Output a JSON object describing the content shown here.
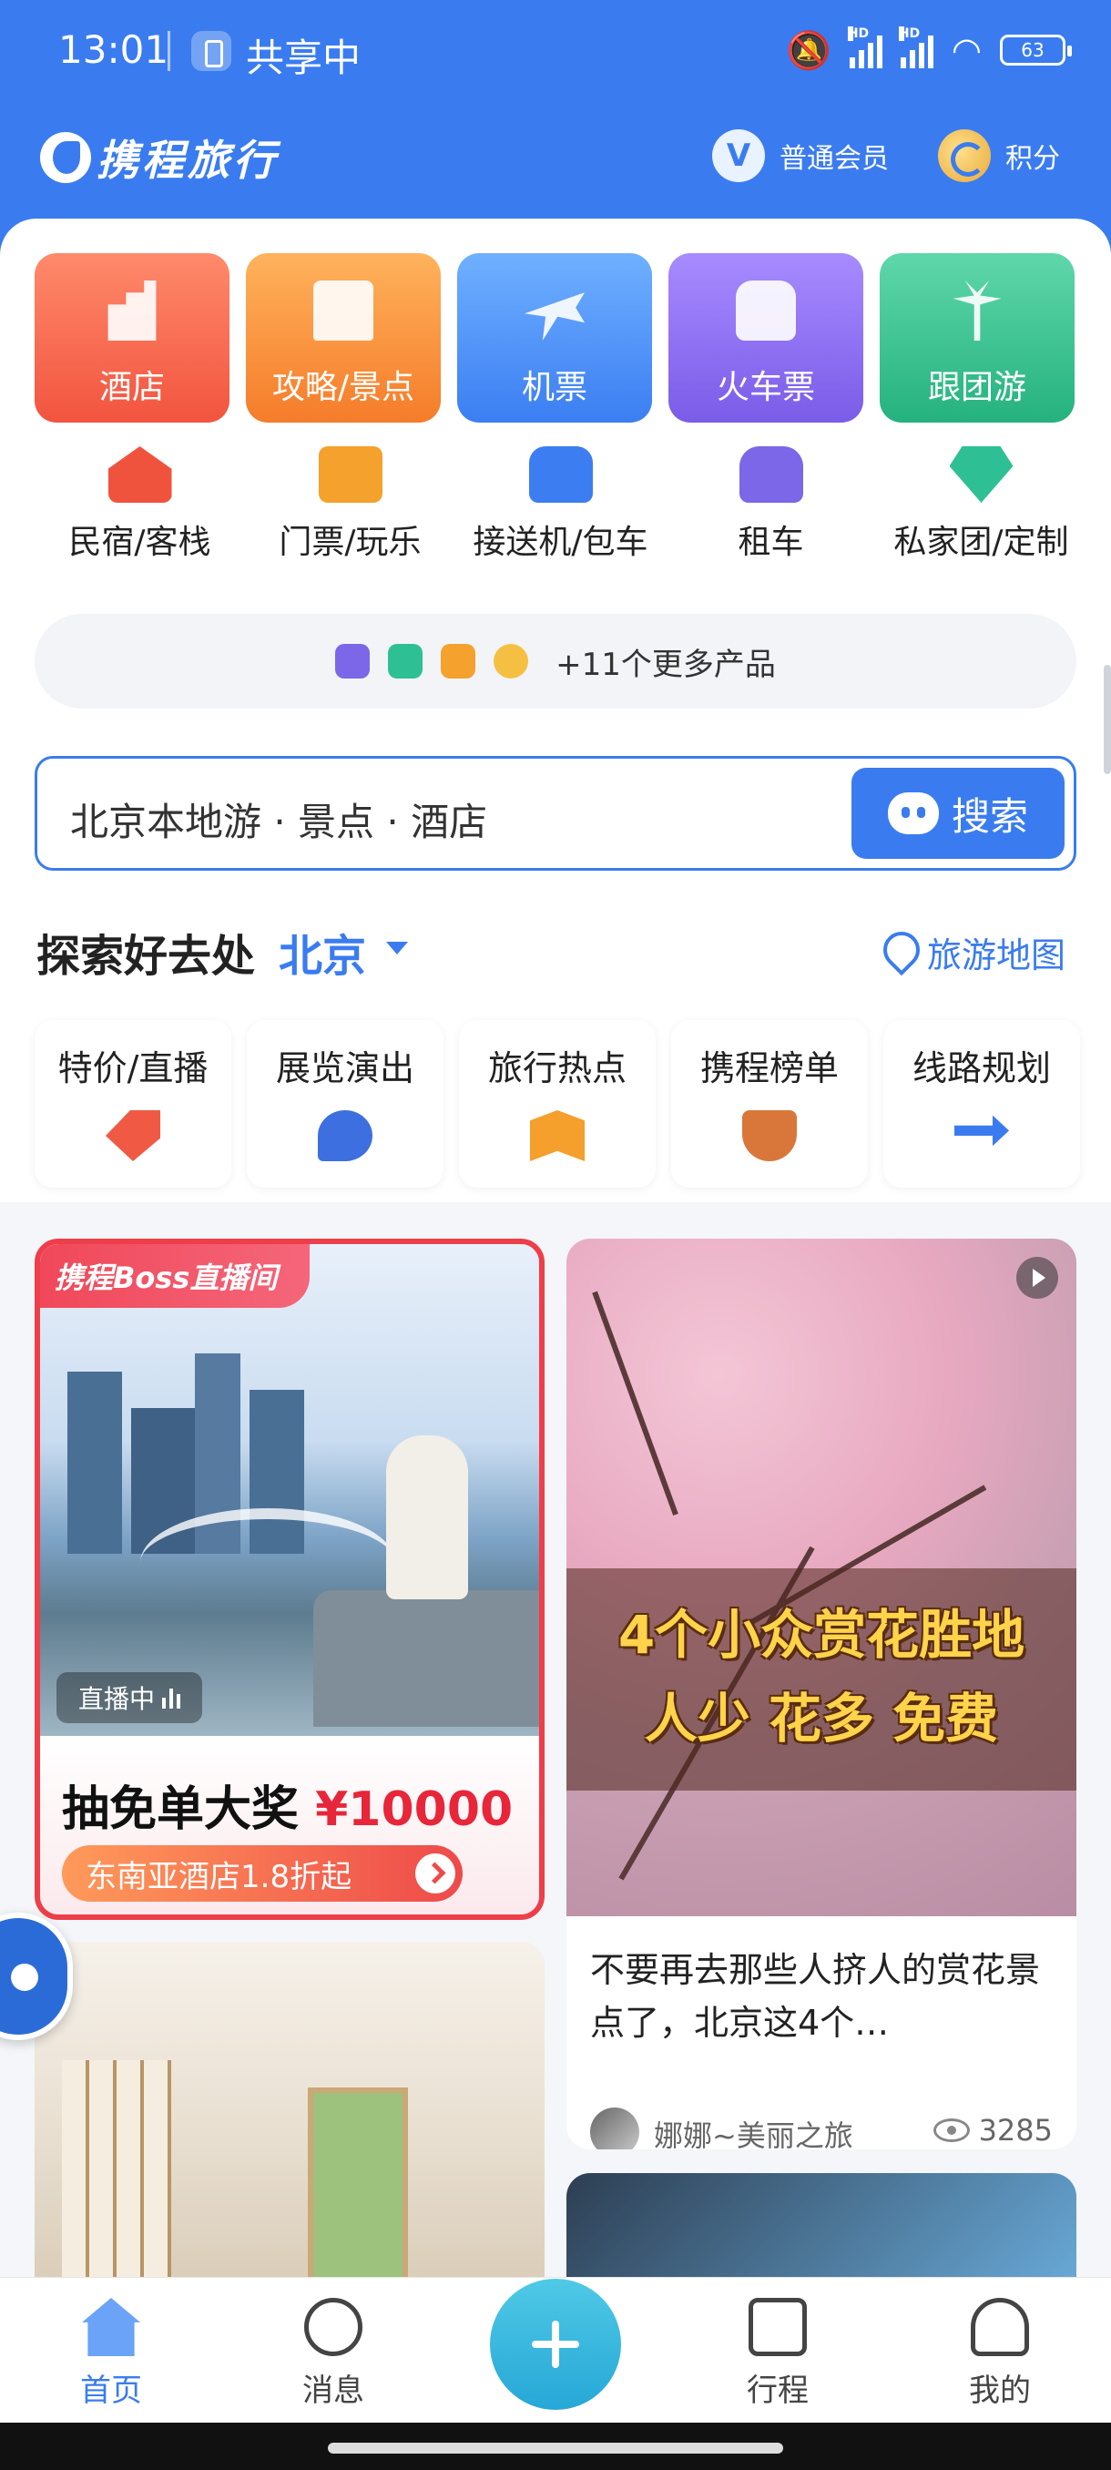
{
  "status_bar": {
    "time": "13:01",
    "sharing": "共享中",
    "battery": "63",
    "signal_label": "HD"
  },
  "header": {
    "logo": "携程旅行",
    "member_level": "普通会员",
    "member_badge": "V",
    "points_label": "积分"
  },
  "main_tiles": [
    {
      "label": "酒店",
      "color": "#f2543f"
    },
    {
      "label": "攻略/景点",
      "color": "#f57c2a"
    },
    {
      "label": "机票",
      "color": "#3b7ef2"
    },
    {
      "label": "火车票",
      "color": "#7a5ce8"
    },
    {
      "label": "跟团游",
      "color": "#25b27e"
    }
  ],
  "sub_services": [
    "民宿/客栈",
    "门票/玩乐",
    "接送机/包车",
    "租车",
    "私家团/定制"
  ],
  "more_products": {
    "label": "+11个更多产品"
  },
  "search": {
    "placeholder": "北京本地游 · 景点 · 酒店",
    "button": "搜索"
  },
  "explore": {
    "title": "探索好去处",
    "city": "北京",
    "map_link": "旅游地图"
  },
  "categories": [
    "特价/直播",
    "展览演出",
    "旅行热点",
    "携程榜单",
    "线路规划"
  ],
  "feed": {
    "live_card": {
      "badge": "携程Boss直播间",
      "status": "直播中",
      "prize": "抽免单大奖",
      "amount": "¥10000",
      "deal": "东南亚酒店1.8折起"
    },
    "blossom_card": {
      "overlay_line1": "4个小众赏花胜地",
      "overlay_line2": "人少 花多 免费",
      "title": "不要再去那些人挤人的赏花景点了，北京这4个…",
      "author": "娜娜~美丽之旅",
      "views": "3285"
    }
  },
  "tabbar": {
    "home": "首页",
    "messages": "消息",
    "trips": "行程",
    "me": "我的"
  },
  "colors": {
    "brand": "#3a7cf0",
    "live_red": "#ee3e4a",
    "blossom_text": "#ffd34a"
  }
}
